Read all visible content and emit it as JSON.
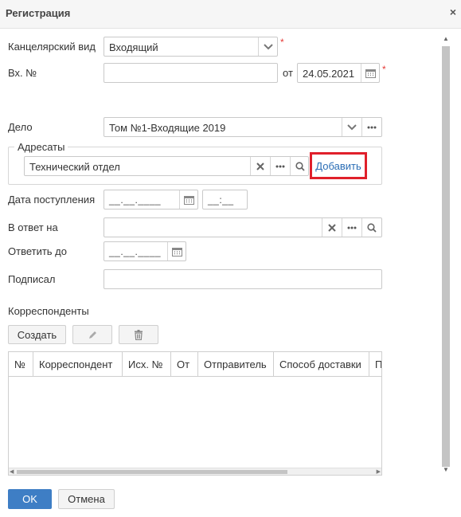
{
  "window": {
    "title": "Регистрация",
    "close_glyph": "×"
  },
  "form": {
    "office_type": {
      "label": "Канцелярский вид",
      "value": "Входящий",
      "required_mark": "*"
    },
    "incoming_no": {
      "label": "Вх. №",
      "value": "",
      "date_label": "от",
      "date_value": "24.05.2021",
      "required_mark": "*"
    },
    "case": {
      "label": "Дело",
      "value": "Том №1-Входящие 2019"
    },
    "addressees": {
      "legend": "Адресаты",
      "value": "Технический отдел",
      "add_label": "Добавить"
    },
    "receipt_date": {
      "label": "Дата поступления",
      "date_placeholder": "__.__.____",
      "time_placeholder": "__:__"
    },
    "reply_to": {
      "label": "В ответ на",
      "value": ""
    },
    "reply_by": {
      "label": "Ответить до",
      "date_placeholder": "__.__.____"
    },
    "signed_by": {
      "label": "Подписал",
      "value": ""
    }
  },
  "correspondents": {
    "title": "Корреспонденты",
    "create_label": "Создать",
    "columns": [
      "№",
      "Корреспондент",
      "Исх. №",
      "От",
      "Отправитель",
      "Способ доставки",
      "П"
    ]
  },
  "footer": {
    "ok_label": "OK",
    "cancel_label": "Отмена"
  },
  "colors": {
    "accent": "#3e7ec5",
    "highlight_border": "#e0202b",
    "link": "#2a6db5",
    "required": "#e53935"
  },
  "icons": [
    "chevron-down-icon",
    "ellipsis-icon",
    "calendar-icon",
    "clear-icon",
    "search-icon",
    "pencil-icon",
    "trash-icon"
  ]
}
